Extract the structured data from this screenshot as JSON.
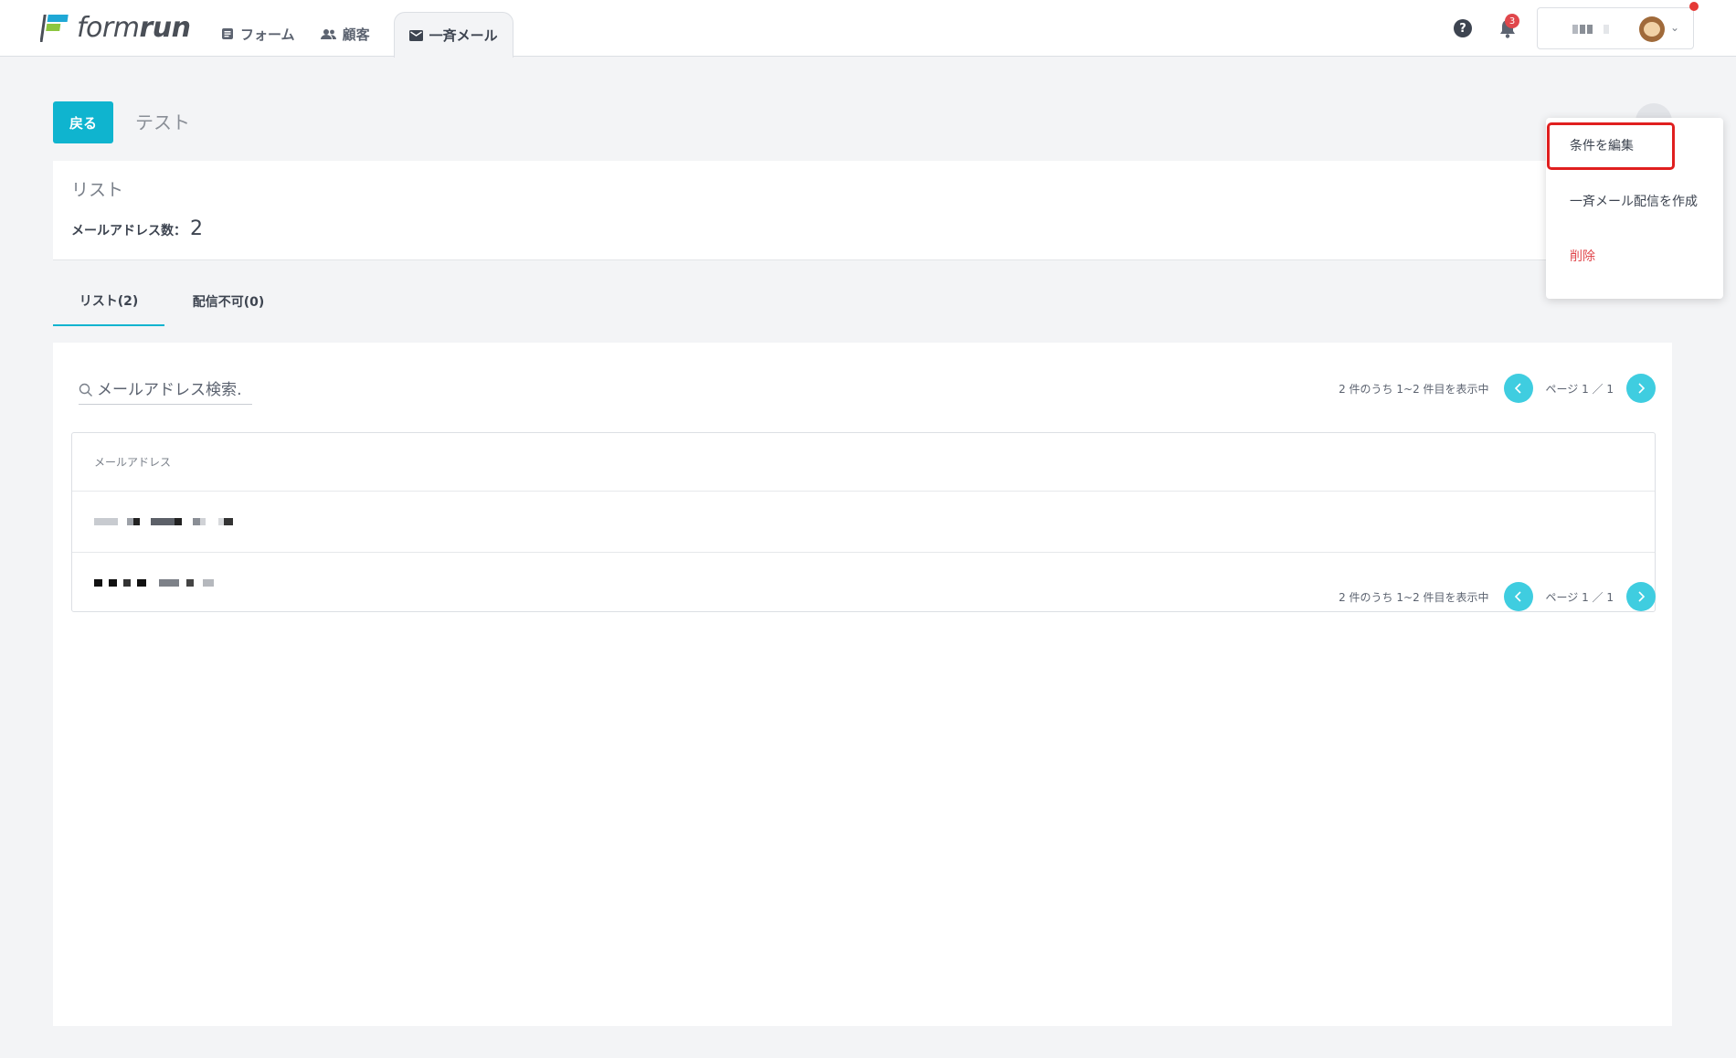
{
  "header": {
    "logo": {
      "text_light": "form",
      "text_bold": "run"
    },
    "nav": [
      {
        "label": "フォーム",
        "icon": "form-icon"
      },
      {
        "label": "顧客",
        "icon": "people-icon"
      },
      {
        "label": "一斉メール",
        "icon": "mail-icon",
        "active": true
      }
    ],
    "help_label": "?",
    "notification_count": "3"
  },
  "page": {
    "back_label": "戻る",
    "title": "テスト"
  },
  "info": {
    "label": "リスト",
    "count_label": "メールアドレス数：",
    "count_value": "2"
  },
  "tabs": [
    {
      "label": "リスト(2)",
      "active": true
    },
    {
      "label": "配信不可(0)",
      "active": false
    }
  ],
  "list": {
    "search_placeholder": "メールアドレス検索…",
    "summary": "2 件のうち 1~2 件目を表示中",
    "page_label": "ページ 1 ／ 1",
    "column_header": "メールアドレス"
  },
  "dropdown": {
    "items": [
      {
        "label": "条件を編集",
        "highlighted": true
      },
      {
        "label": "一斉メール配信を作成"
      },
      {
        "label": "削除",
        "danger": true
      }
    ]
  },
  "colors": {
    "accent": "#0fb4cf",
    "pager_button": "#3fcde0",
    "danger": "#e0474c",
    "highlight_border": "#e01f1f"
  }
}
